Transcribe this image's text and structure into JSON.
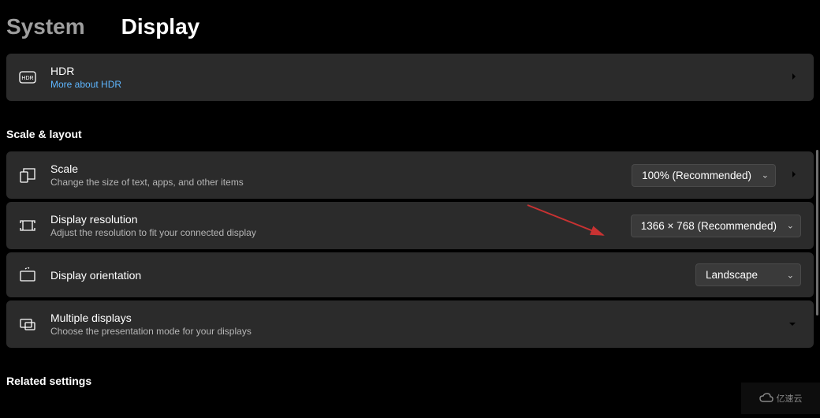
{
  "breadcrumb": {
    "parent": "System",
    "current": "Display"
  },
  "hdr": {
    "title": "HDR",
    "link": "More about HDR"
  },
  "sections": {
    "scale_layout_header": "Scale & layout",
    "related_header": "Related settings"
  },
  "scale": {
    "title": "Scale",
    "sub": "Change the size of text, apps, and other items",
    "value": "100% (Recommended)"
  },
  "resolution": {
    "title": "Display resolution",
    "sub": "Adjust the resolution to fit your connected display",
    "value": "1366 × 768 (Recommended)"
  },
  "orientation": {
    "title": "Display orientation",
    "value": "Landscape"
  },
  "multiple": {
    "title": "Multiple displays",
    "sub": "Choose the presentation mode for your displays"
  },
  "watermark": "亿速云"
}
